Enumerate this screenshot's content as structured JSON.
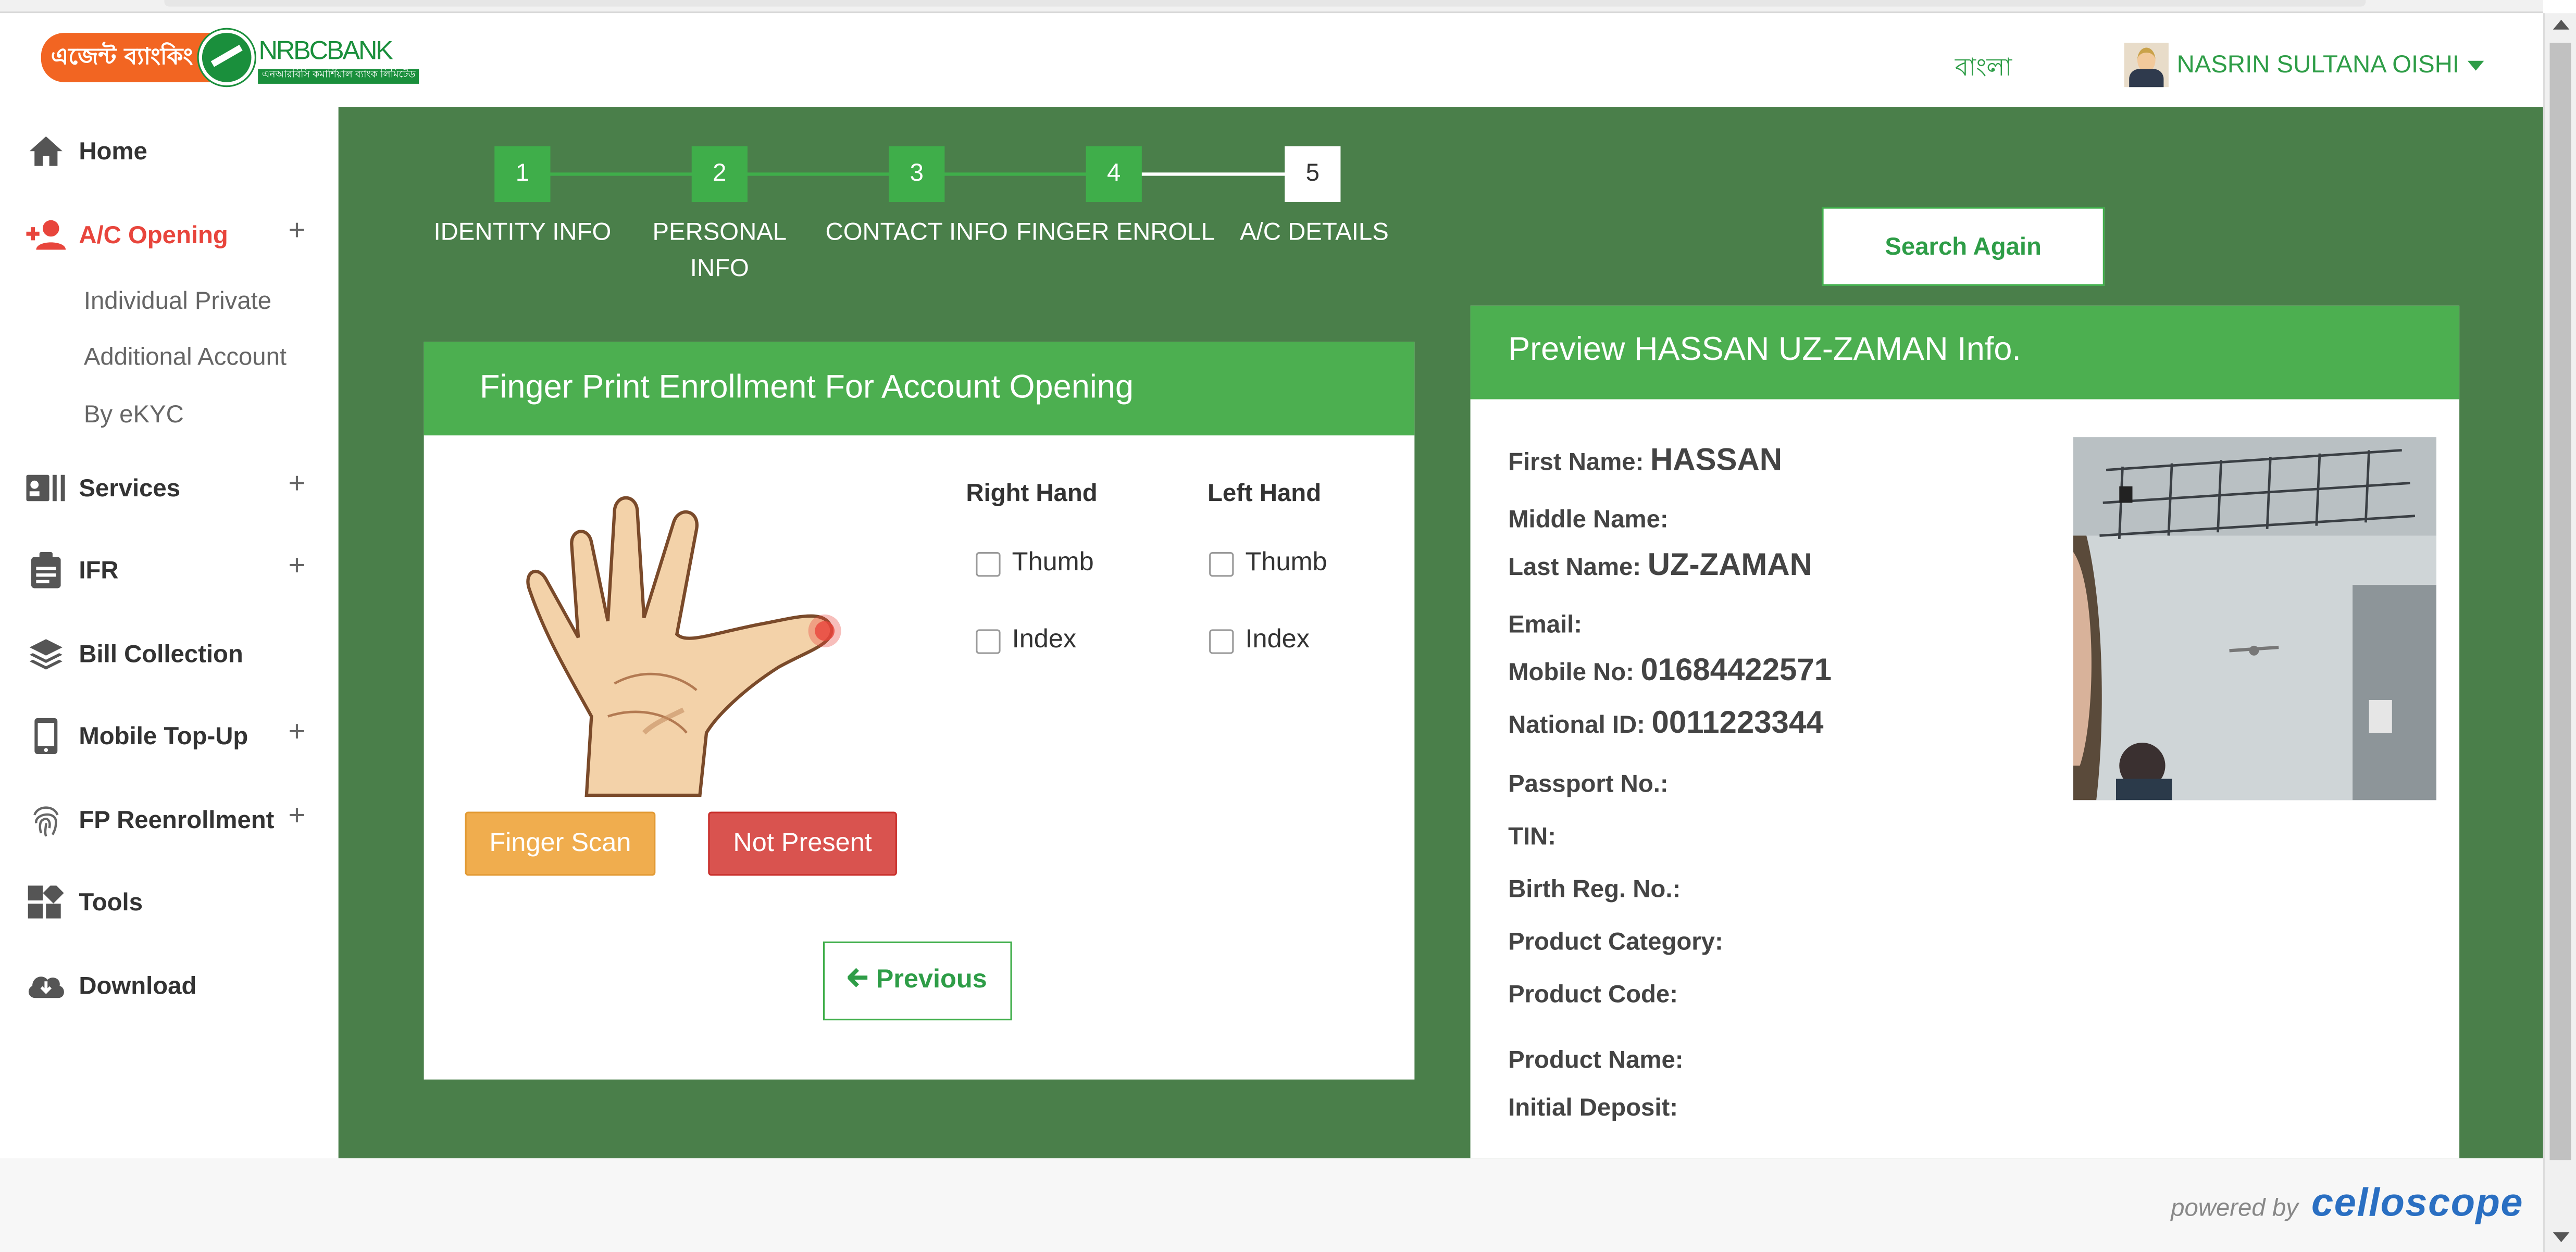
{
  "header": {
    "logo_bn": "এজেন্ট ব্যাংকিং",
    "logo_brand": "NRBC",
    "logo_brand2": "BANK",
    "logo_tagline": "এনআরবিসি কমার্শিয়াল ব্যাংক লিমিটেড",
    "language_link": "বাংলা",
    "user_name": "NASRIN SULTANA OISHI"
  },
  "sidebar": {
    "items": [
      {
        "label": "Home",
        "icon": "home-icon"
      },
      {
        "label": "A/C Opening",
        "icon": "add-user-icon",
        "active": true,
        "sub": [
          "Individual Private",
          "Additional Account",
          "By eKYC"
        ]
      },
      {
        "label": "Services",
        "icon": "id-card-icon"
      },
      {
        "label": "IFR",
        "icon": "clipboard-icon"
      },
      {
        "label": "Bill Collection",
        "icon": "layers-icon"
      },
      {
        "label": "Mobile Top-Up",
        "icon": "mobile-icon"
      },
      {
        "label": "FP Reenrollment",
        "icon": "fingerprint-icon"
      },
      {
        "label": "Tools",
        "icon": "tools-icon"
      },
      {
        "label": "Download",
        "icon": "cloud-download-icon"
      }
    ],
    "expand_symbol": "+"
  },
  "wizard": {
    "steps": [
      {
        "number": "1",
        "label_line1": "IDENTITY INFO",
        "label_line2": ""
      },
      {
        "number": "2",
        "label_line1": "PERSONAL",
        "label_line2": "INFO"
      },
      {
        "number": "3",
        "label_line1": "CONTACT INFO",
        "label_line2": ""
      },
      {
        "number": "4",
        "label_line1": "FINGER ENROLL",
        "label_line2": ""
      },
      {
        "number": "5",
        "label_line1": "A/C DETAILS",
        "label_line2": ""
      }
    ],
    "current_step": 5,
    "search_again": "Search Again"
  },
  "enrollment": {
    "title": "Finger Print Enrollment For Account Opening",
    "right_hand": "Right Hand",
    "left_hand": "Left Hand",
    "thumb": "Thumb",
    "index": "Index",
    "finger_scan": "Finger Scan",
    "not_present": "Not Present",
    "previous": "Previous"
  },
  "preview": {
    "title": "Preview HASSAN UZ-ZAMAN Info.",
    "fields": [
      {
        "label": "First Name:",
        "value": "HASSAN"
      },
      {
        "label": "Middle Name:",
        "value": ""
      },
      {
        "label": "Last Name:",
        "value": "UZ-ZAMAN"
      },
      {
        "label": "Email:",
        "value": ""
      },
      {
        "label": "Mobile No:",
        "value": "01684422571"
      },
      {
        "label": "National ID:",
        "value": "0011223344"
      },
      {
        "label": "Passport No.:",
        "value": ""
      },
      {
        "label": "TIN:",
        "value": ""
      },
      {
        "label": "Birth Reg. No.:",
        "value": ""
      },
      {
        "label": "Product Category:",
        "value": ""
      },
      {
        "label": "Product Code:",
        "value": ""
      },
      {
        "label": "Product Name:",
        "value": ""
      },
      {
        "label": "Initial Deposit:",
        "value": ""
      }
    ]
  },
  "footer": {
    "powered_by": "powered by",
    "brand": "celloscope"
  },
  "colors": {
    "main_bg": "#4a7f4a",
    "accent_green": "#4caf50",
    "step_green": "#3fae4a",
    "active_red": "#e8453c",
    "warning_orange": "#f0ad4e",
    "danger_red": "#d9534f",
    "brand_blue": "#2a6fc2"
  }
}
